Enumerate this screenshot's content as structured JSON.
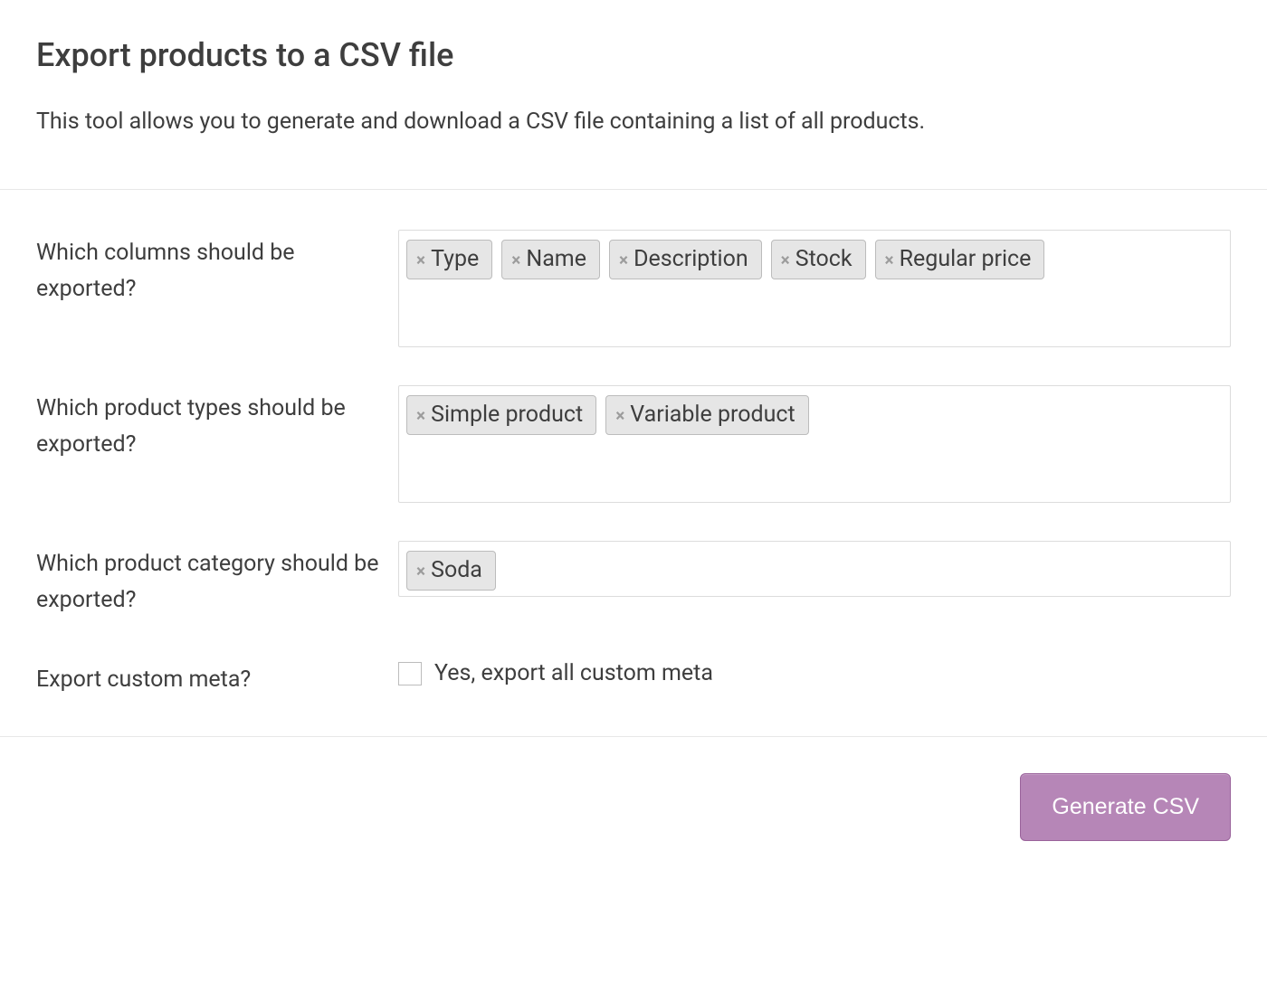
{
  "header": {
    "title": "Export products to a CSV file",
    "description": "This tool allows you to generate and download a CSV file containing a list of all products."
  },
  "form": {
    "columns": {
      "label": "Which columns should be exported?",
      "tags": [
        "Type",
        "Name",
        "Description",
        "Stock",
        "Regular price"
      ]
    },
    "product_types": {
      "label": "Which product types should be exported?",
      "tags": [
        "Simple product",
        "Variable product"
      ]
    },
    "category": {
      "label": "Which product category should be exported?",
      "tags": [
        "Soda"
      ]
    },
    "custom_meta": {
      "label": "Export custom meta?",
      "checkbox_label": "Yes, export all custom meta",
      "checked": false
    }
  },
  "footer": {
    "generate_button": "Generate CSV"
  },
  "glyphs": {
    "remove": "×"
  }
}
